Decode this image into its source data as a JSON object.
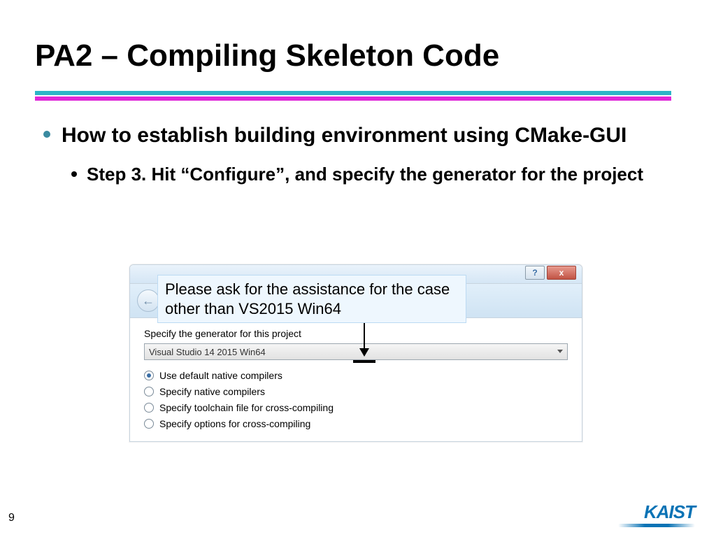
{
  "title": "PA2 – Compiling Skeleton Code",
  "bullets": {
    "level1": "How to establish building environment using CMake-GUI",
    "level2": "Step 3. Hit “Configure”, and specify the generator for the project"
  },
  "callout": "Please ask for the assistance for the case other than VS2015 Win64",
  "dialog": {
    "titlebar": {
      "help": "?",
      "close": "x"
    },
    "prompt": "Specify the generator for this project",
    "combo": {
      "value": "Visual Studio 14 2015 Win64"
    },
    "radios": [
      "Use default native compilers",
      "Specify native compilers",
      "Specify toolchain file for cross-compiling",
      "Specify options for cross-compiling"
    ]
  },
  "page": "9",
  "logo": "KAIST",
  "colors": {
    "cyan": "#2db5c7",
    "magenta": "#e028d8",
    "brand": "#0a73b5"
  }
}
